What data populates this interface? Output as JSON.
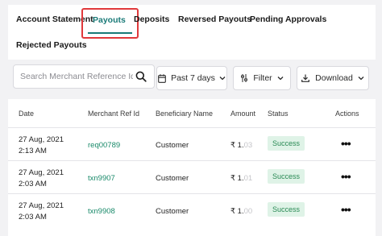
{
  "tabs": [
    {
      "label": "Account Statement"
    },
    {
      "label": "Payouts"
    },
    {
      "label": "Deposits"
    },
    {
      "label": "Reversed Payouts"
    },
    {
      "label": "Pending Approvals"
    },
    {
      "label": "Rejected Payouts"
    }
  ],
  "active_tab": "Payouts",
  "toolbar": {
    "search_placeholder": "Search Merchant Reference Id",
    "date_filter": "Past 7 days",
    "filter_label": "Filter",
    "download_label": "Download"
  },
  "table": {
    "headers": [
      "Date",
      "Merchant Ref Id",
      "Beneficiary Name",
      "Amount",
      "Status",
      "Actions"
    ],
    "rows": [
      {
        "date": "27 Aug, 2021",
        "time": "2:13 AM",
        "ref": "req00789",
        "beneficiary": "Customer",
        "amount_main": "₹ 1.",
        "amount_faint": "03",
        "status": "Success"
      },
      {
        "date": "27 Aug, 2021",
        "time": "2:03 AM",
        "ref": "txn9907",
        "beneficiary": "Customer",
        "amount_main": "₹ 1.",
        "amount_faint": "01",
        "status": "Success"
      },
      {
        "date": "27 Aug, 2021",
        "time": "2:03 AM",
        "ref": "txn9908",
        "beneficiary": "Customer",
        "amount_main": "₹ 1.",
        "amount_faint": "00",
        "status": "Success"
      }
    ]
  },
  "colors": {
    "accent": "#1a7a78",
    "highlight_border": "#e0393b",
    "success_bg": "#dff3e7",
    "success_text": "#2a8a55",
    "link": "#1a8a6a"
  },
  "icons": [
    "search-icon",
    "calendar-icon",
    "chevron-down-icon",
    "download-icon",
    "more-dots-icon"
  ]
}
